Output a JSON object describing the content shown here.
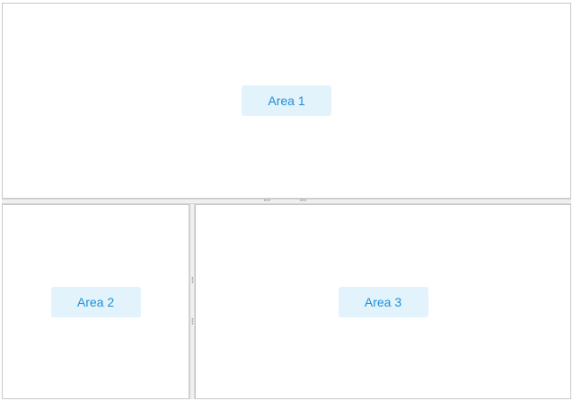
{
  "areas": {
    "area1": {
      "label": "Area 1"
    },
    "area2": {
      "label": "Area 2"
    },
    "area3": {
      "label": "Area 3"
    }
  },
  "splitters": {
    "grip_glyph": "•••"
  },
  "colors": {
    "label_background": "#e3f3fc",
    "label_text": "#1b8fd8",
    "pane_border": "#c8c8c8",
    "splitter_background": "#f0f0f0"
  }
}
